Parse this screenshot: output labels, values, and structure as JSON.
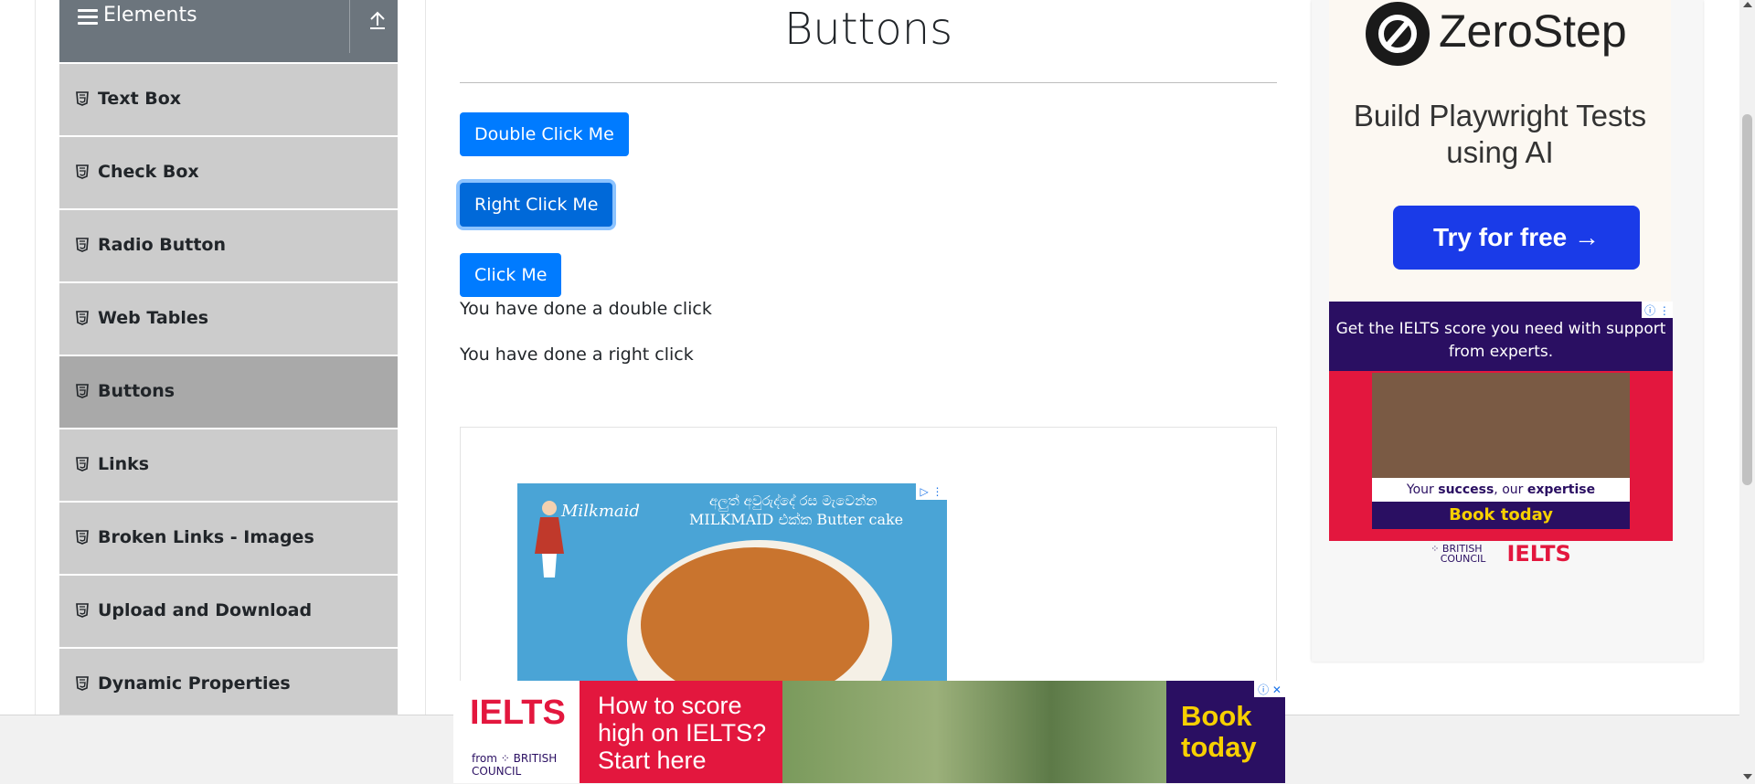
{
  "sidebar": {
    "group_title": "Elements",
    "items": [
      {
        "label": "Text Box",
        "active": false
      },
      {
        "label": "Check Box",
        "active": false
      },
      {
        "label": "Radio Button",
        "active": false
      },
      {
        "label": "Web Tables",
        "active": false
      },
      {
        "label": "Buttons",
        "active": true
      },
      {
        "label": "Links",
        "active": false
      },
      {
        "label": "Broken Links - Images",
        "active": false
      },
      {
        "label": "Upload and Download",
        "active": false
      },
      {
        "label": "Dynamic Properties",
        "active": false
      }
    ]
  },
  "main": {
    "title": "Buttons",
    "double_click_button": "Double Click Me",
    "right_click_button": "Right Click Me",
    "click_button": "Click Me",
    "double_click_message": "You have done a double click",
    "right_click_message": "You have done a right click"
  },
  "ads": {
    "zerostep": {
      "name": "ZeroStep",
      "tagline": "Build Playwright Tests using AI",
      "cta": "Try for free →"
    },
    "ielts_side": {
      "headline": "Get the IELTS score you need with support from experts.",
      "tagline_pre": "Your ",
      "tagline_b1": "success",
      "tagline_mid": ", our ",
      "tagline_b2": "expertise",
      "cta": "Book today",
      "council_line1": "BRITISH",
      "council_line2": "COUNCIL",
      "brand": "IELTS"
    },
    "milkmaid": {
      "brand": "Milkmaid",
      "line1": "අලුත් අවුරුද්දේ රස මැවෙන්න",
      "line2": "MILKMAID එක්ක Butter cake"
    },
    "ielts_bottom": {
      "brand": "IELTS",
      "from": "from",
      "council": "BRITISH COUNCIL",
      "headline": "How to score high on IELTS? Start here",
      "cta": "Book today"
    }
  },
  "colors": {
    "primary": "#007bff",
    "sidebar_header": "#6c757d",
    "sidebar_item": "#cccccc",
    "sidebar_active": "#a9a9a9"
  }
}
